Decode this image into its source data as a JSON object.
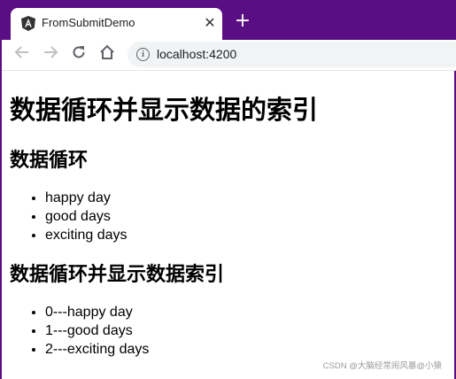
{
  "browser": {
    "tab_title": "FromSubmitDemo",
    "url": "localhost:4200",
    "accent_color": "#5a0e84"
  },
  "page": {
    "title": "数据循环并显示数据的索引",
    "section1": {
      "heading": "数据循环",
      "items": [
        "happy day",
        "good days",
        "exciting days"
      ]
    },
    "section2": {
      "heading": "数据循环并显示数据索引",
      "items": [
        "0---happy day",
        "1---good days",
        "2---exciting days"
      ]
    }
  },
  "watermark": "CSDN @大脑经常闹风暴@小猿"
}
